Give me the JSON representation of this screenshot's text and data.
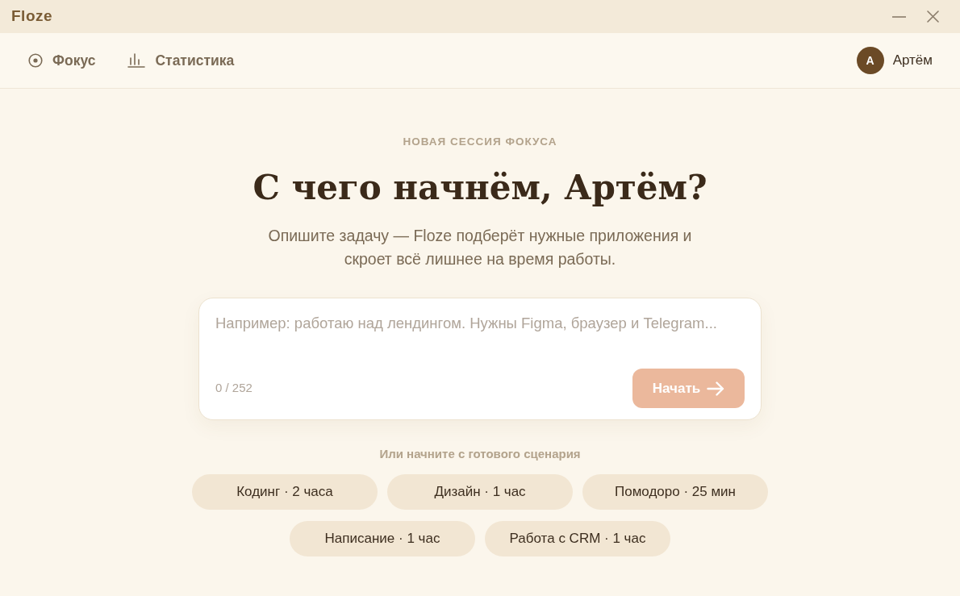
{
  "window": {
    "title": "Floze"
  },
  "nav": {
    "items": [
      {
        "label": "Фокус"
      },
      {
        "label": "Статистика"
      }
    ]
  },
  "user": {
    "initial": "А",
    "name": "Артём"
  },
  "hero": {
    "eyebrow": "НОВАЯ СЕССИЯ ФОКУСА",
    "title": "С чего начнём, Артём?",
    "subtitle": "Опишите задачу — Floze подберёт нужные приложения и\nскроет всё лишнее на время работы."
  },
  "task_input": {
    "placeholder": "Например: работаю над лендингом. Нужны Figma, браузер и Telegram...",
    "counter": "0 / 252",
    "start_button": {
      "label": "Начать",
      "disabled": true
    }
  },
  "presets": {
    "heading": "Или начните с готового сценария",
    "items": [
      {
        "label": "Кодинг · 2 часа"
      },
      {
        "label": "Дизайн · 1 час"
      },
      {
        "label": "Помодоро · 25 мин"
      },
      {
        "label": "Написание · 1 час"
      },
      {
        "label": "Работа с CRM · 1 час"
      }
    ]
  }
}
